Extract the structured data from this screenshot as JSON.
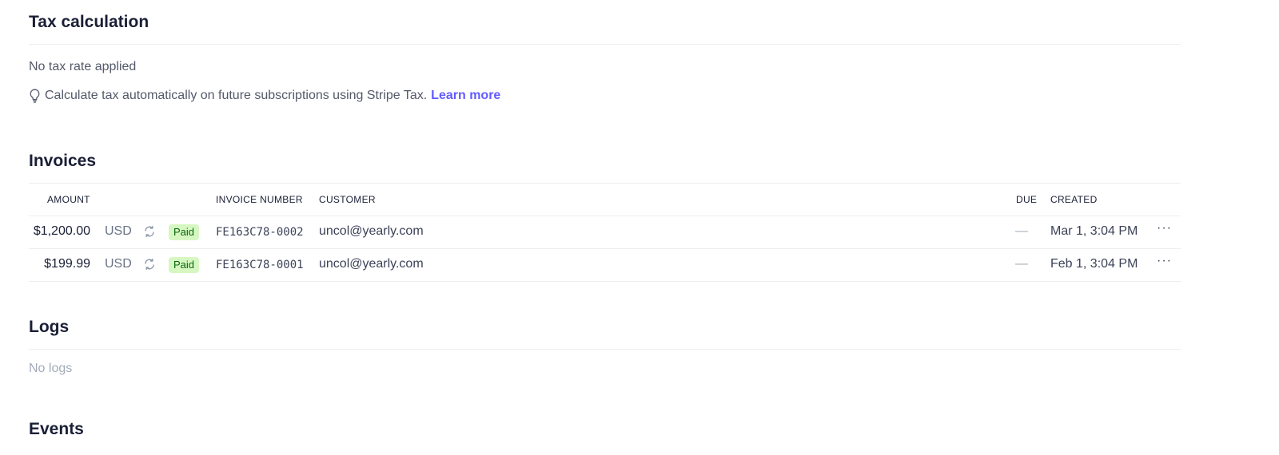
{
  "tax": {
    "title": "Tax calculation",
    "status": "No tax rate applied",
    "tip_text": "Calculate tax automatically on future subscriptions using Stripe Tax.",
    "tip_link": "Learn more"
  },
  "invoices": {
    "title": "Invoices",
    "columns": {
      "amount": "AMOUNT",
      "invoice_number": "INVOICE NUMBER",
      "customer": "CUSTOMER",
      "due": "DUE",
      "created": "CREATED"
    },
    "rows": [
      {
        "amount": "$1,200.00",
        "currency": "USD",
        "status": "Paid",
        "invoice_number": "FE163C78-0002",
        "customer": "uncol@yearly.com",
        "due": "—",
        "created": "Mar 1, 3:04 PM",
        "more": "···"
      },
      {
        "amount": "$199.99",
        "currency": "USD",
        "status": "Paid",
        "invoice_number": "FE163C78-0001",
        "customer": "uncol@yearly.com",
        "due": "—",
        "created": "Feb 1, 3:04 PM",
        "more": "···"
      }
    ]
  },
  "logs": {
    "title": "Logs",
    "empty": "No logs"
  },
  "events": {
    "title": "Events"
  },
  "icons": {
    "tip": "lightbulb-icon",
    "recurring": "refresh-icon",
    "more": "more-icon"
  },
  "colors": {
    "link": "#635bff",
    "paid_bg": "#d7f7c2",
    "paid_text": "#05690d"
  }
}
